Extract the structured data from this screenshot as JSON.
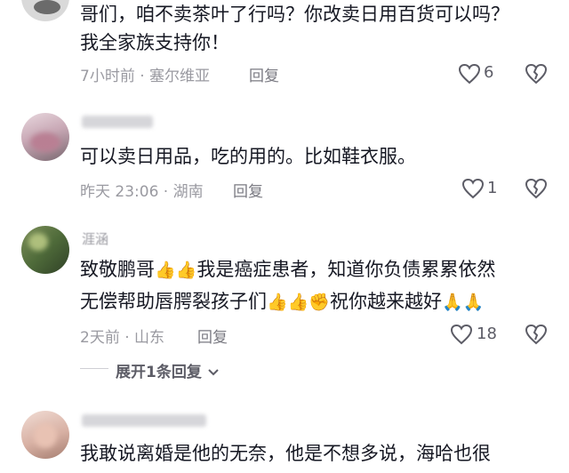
{
  "comments": [
    {
      "lines": [
        "哥们，咱不卖茶叶了行吗？你改卖日用百货可以吗？",
        "我全家族支持你！"
      ],
      "meta": "7小时前 · 塞尔维亚",
      "reply": "回复",
      "likes": "6"
    },
    {
      "lines": [
        "可以卖日用品，吃的用的。比如鞋衣服。"
      ],
      "meta": "昨天 23:06 · 湖南",
      "reply": "回复",
      "likes": "1"
    },
    {
      "name": "涯涵",
      "lines": [
        "致敬鹏哥",
        "我是癌症患者，知道你负债累累依然",
        "无偿帮助唇腭裂孩子们",
        "祝你越来越好"
      ],
      "meta": "2天前 · 山东",
      "reply": "回复",
      "likes": "18"
    },
    {
      "lines": [
        "我敢说离婚是他的无奈，他是不想多说，海哈也很"
      ]
    }
  ],
  "expand_label": "展开1条回复",
  "icons": [
    "heart-outline-icon",
    "broken-heart-icon",
    "chevron-down-icon",
    "thumbs-up-emoji",
    "fist-emoji",
    "praying-hands-emoji"
  ],
  "colors": {
    "text": "#161823",
    "meta": "#9a9aa1",
    "icon": "#5c5c66"
  }
}
